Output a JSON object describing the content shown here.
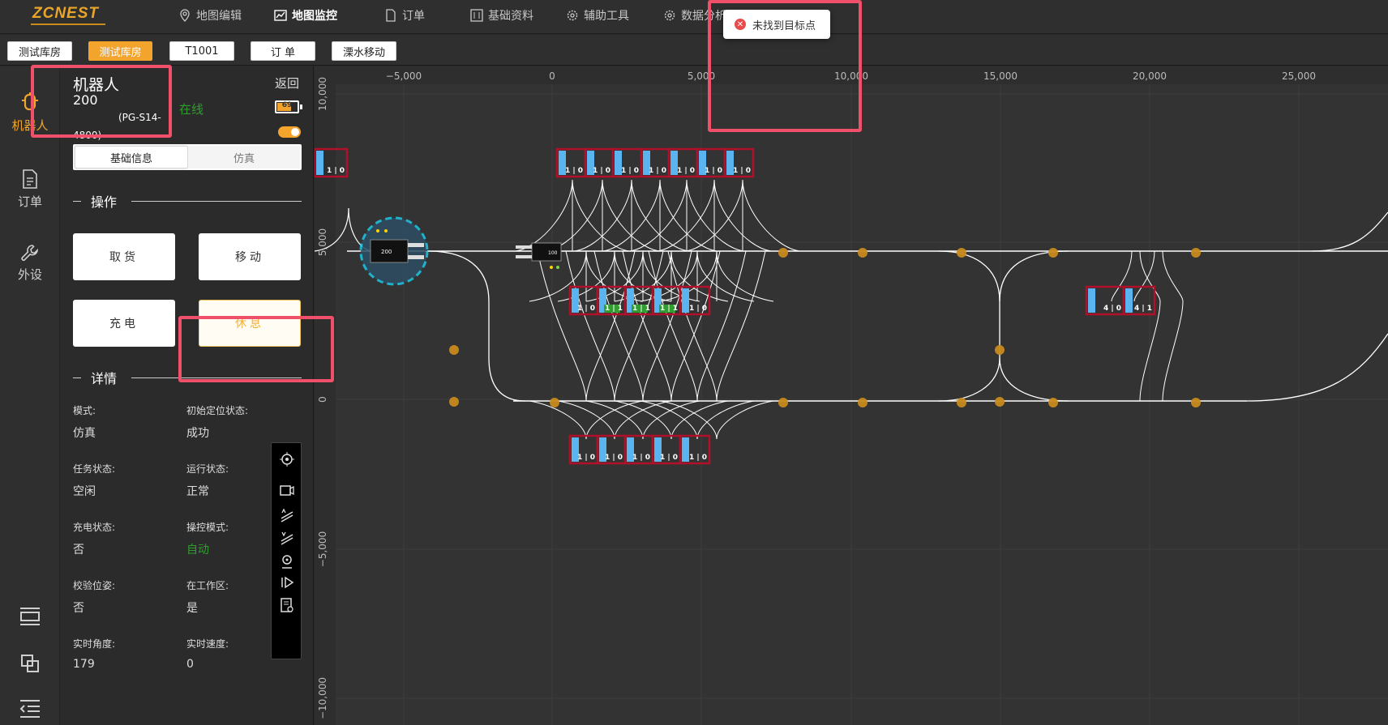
{
  "app": {
    "logo": "ZCNEST"
  },
  "nav": [
    {
      "label": "地图编辑",
      "icon": "map-pin-icon"
    },
    {
      "label": "地图监控",
      "icon": "chart-monitor-icon",
      "active": true
    },
    {
      "label": "订单",
      "icon": "document-icon"
    },
    {
      "label": "基础资料",
      "icon": "sliders-icon"
    },
    {
      "label": "辅助工具",
      "icon": "gear-icon"
    },
    {
      "label": "数据分析",
      "icon": "gear-icon"
    }
  ],
  "page_tabs": [
    {
      "label": "测试库房"
    },
    {
      "label": "测试库房",
      "active": true
    },
    {
      "label": "T1001"
    },
    {
      "label": "订 单"
    },
    {
      "label": "溧水移动"
    }
  ],
  "leftnav": [
    {
      "label": "机器人",
      "icon": "robot-icon",
      "active": true
    },
    {
      "label": "订单",
      "icon": "order-doc-icon"
    },
    {
      "label": "外设",
      "icon": "wrench-icon"
    }
  ],
  "robot": {
    "title": "机器人",
    "id": "200",
    "model_a": "(PG-S14-",
    "model_b": "4800)",
    "status": "在线",
    "back": "返回",
    "battery": "69",
    "battery_level": 0.69,
    "toggle_on": true
  },
  "segment": {
    "tab1": "基础信息",
    "tab2": "仿真"
  },
  "sections": {
    "operations": "操作",
    "details": "详情"
  },
  "operations": {
    "pickup": "取货",
    "move": "移动",
    "charge": "充电",
    "rest": "休息"
  },
  "details": {
    "mode_label": "模式:",
    "mode": "仿真",
    "init_label": "初始定位状态:",
    "init": "成功",
    "task_label": "任务状态:",
    "task": "空闲",
    "run_label": "运行状态:",
    "run": "正常",
    "charge_label": "充电状态:",
    "charge": "否",
    "control_label": "操控模式:",
    "control": "自动",
    "verify_label": "校验位姿:",
    "verify": "否",
    "workzone_label": "在工作区:",
    "workzone": "是",
    "angle_label": "实时角度:",
    "angle": "179",
    "speed_label": "实时速度:",
    "speed": "0"
  },
  "toast": {
    "message": "未找到目标点"
  },
  "map": {
    "x_ticks": [
      "−5,000",
      "0",
      "5,000",
      "10,000",
      "15,000",
      "20,000",
      "25,000"
    ],
    "y_ticks": [
      "10,000",
      "5,000",
      "0",
      "−5,000",
      "−10,000"
    ],
    "robots": [
      {
        "label": "200"
      },
      {
        "label": "100"
      }
    ],
    "slot_labels": {
      "row_top": [
        "1 | 0",
        "1 | 0",
        "1 | 0",
        "1 | 0",
        "1 | 0",
        "1 | 0",
        "1 | 0"
      ],
      "row_mid": [
        "1 | 0",
        "1 | 1",
        "1 | 1",
        "1 | 1",
        "1 | 0"
      ],
      "row_mid_right": [
        "4 | 0",
        "4 | 1"
      ],
      "row_bottom": [
        "1 | 0",
        "1 | 0",
        "1 | 0",
        "1 | 0",
        "1 | 0"
      ]
    },
    "colors": {
      "background": "#333333",
      "path": "#ffffff",
      "node": "#c88a1e",
      "slot_border": "#b0102a",
      "slot_blue": "#5ab4ef",
      "slot_green": "#2f9e2f",
      "robot_circle": "#1ec8e6"
    }
  }
}
